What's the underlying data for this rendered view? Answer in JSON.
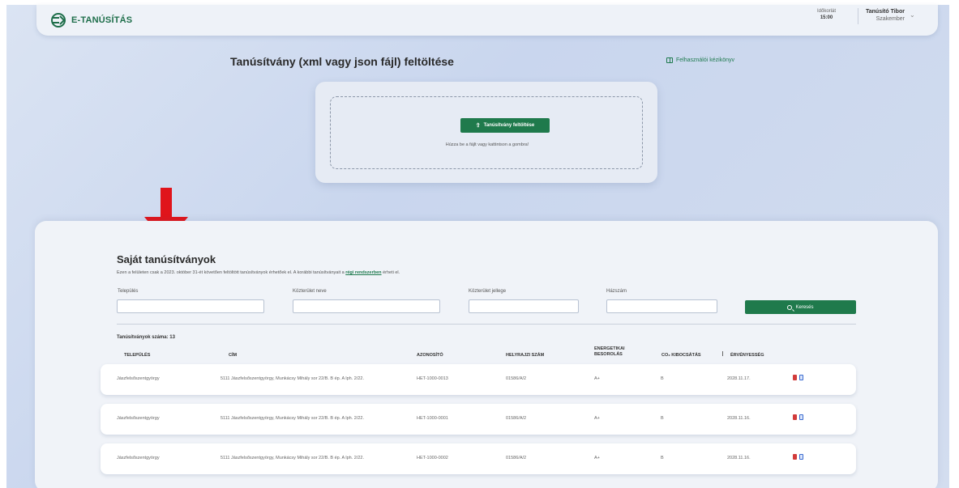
{
  "header": {
    "logo_text": "E-TANÚSÍTÁS",
    "session_label": "Időkorlát",
    "session_time": "15:00",
    "user_name": "Tanúsító Tibor",
    "user_role": "Szakember"
  },
  "upload": {
    "title": "Tanúsítvány (xml vagy json fájl) feltöltése",
    "manual_link": "Felhasználói kézikönyv",
    "button_label": "Tanúsítvány feltöltése",
    "hint": "Húzza be a fájlt vagy kattintson a gombra!"
  },
  "certificates": {
    "title": "Saját tanúsítványok",
    "desc_prefix": "Ezen a felületen csak a 2023. október 31-ét követően feltöltött tanúsítványok érhetőek el. A korábbi tanúsítványait a ",
    "desc_link": "régi rendszerben",
    "desc_suffix": " érheti el.",
    "filters": {
      "settlement_label": "Település",
      "street_label": "Közterület neve",
      "street_type_label": "Közterület jellege",
      "house_label": "Házszám",
      "search_label": "Keresés"
    },
    "count_text": "Tanúsítványok száma: 13",
    "columns": {
      "settlement": "Település",
      "address": "Cím",
      "id": "Azonosító",
      "parcel": "Helyrajzi szám",
      "energy_1": "Energetikai",
      "energy_2": "besorolás",
      "co2": "CO₂ kibocsátás",
      "validity": "Érvényesség"
    },
    "rows": [
      {
        "settlement": "Jászfelsőszentgyörgy",
        "address": "5111 Jászfelsőszentgyörgy, Munkácsy Mihály sor 22/B. B ép. A lph. 2/22.",
        "id": "HET-1000-0013",
        "parcel": "01586/A/2",
        "energy": "A+",
        "co2": "B",
        "validity": "2028.11.17."
      },
      {
        "settlement": "Jászfelsőszentgyörgy",
        "address": "5111 Jászfelsőszentgyörgy, Munkácsy Mihály sor 22/B. B ép. A lph. 2/22.",
        "id": "HET-1000-0001",
        "parcel": "01586/A/2",
        "energy": "A+",
        "co2": "B",
        "validity": "2028.11.16."
      },
      {
        "settlement": "Jászfelsőszentgyörgy",
        "address": "5111 Jászfelsőszentgyörgy, Munkácsy Mihály sor 22/B. B ép. A lph. 2/22.",
        "id": "HET-1000-0002",
        "parcel": "01586/A/2",
        "energy": "A+",
        "co2": "B",
        "validity": "2028.11.16."
      }
    ]
  },
  "colors": {
    "brand_green": "#1f7a4c",
    "arrow_red": "#e0141b"
  }
}
